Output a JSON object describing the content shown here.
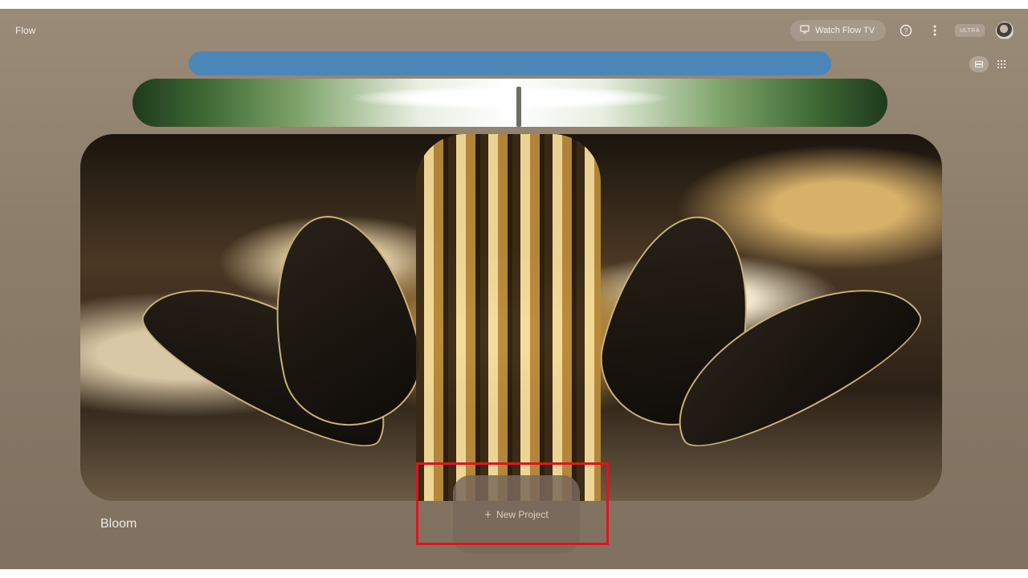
{
  "app": {
    "title": "Flow"
  },
  "header": {
    "watch_tv_label": "Watch Flow TV",
    "plan_badge": "ULTRA",
    "icons": [
      "tv-icon",
      "help-icon",
      "more-vert-icon",
      "avatar"
    ]
  },
  "view_toggle": {
    "options": [
      "list-view-icon",
      "grid-view-icon"
    ],
    "selected": "list-view-icon"
  },
  "main": {
    "featured_project": {
      "title": "Bloom"
    },
    "new_project_label": "New Project"
  },
  "colors": {
    "highlight": "#e0141e",
    "back_card": "#4a87b8"
  }
}
